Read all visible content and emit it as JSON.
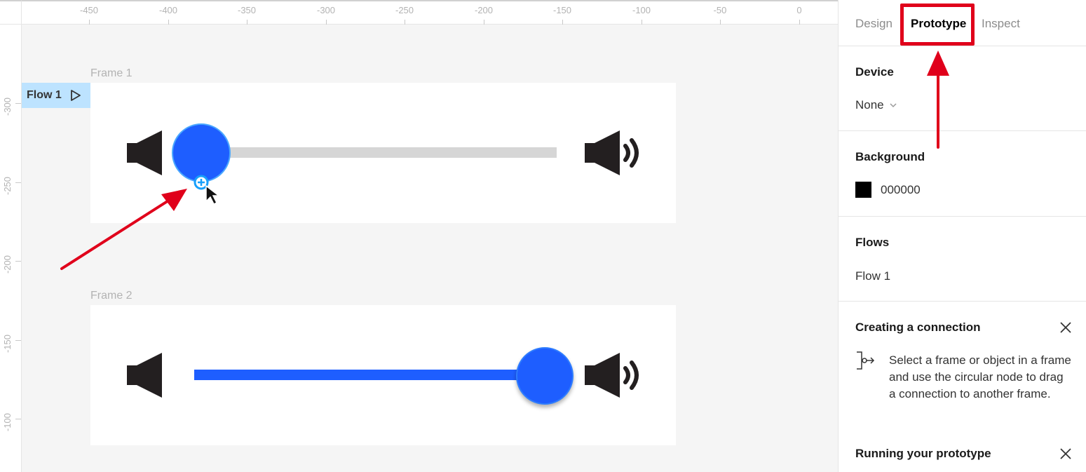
{
  "ruler": {
    "top_ticks": [
      "-450",
      "-400",
      "-350",
      "-300",
      "-250",
      "-200",
      "-150",
      "-100",
      "-50",
      "0"
    ],
    "left_ticks": [
      "-300",
      "-250",
      "-200",
      "-150",
      "-100"
    ]
  },
  "canvas": {
    "frame1_label": "Frame 1",
    "frame2_label": "Frame 2",
    "flow_tag": "Flow 1",
    "accent_color": "#1E5EFF",
    "frame1_slider_level": 0.0,
    "frame2_slider_level": 1.0
  },
  "panel": {
    "tabs": [
      {
        "label": "Design",
        "active": false
      },
      {
        "label": "Prototype",
        "active": true
      },
      {
        "label": "Inspect",
        "active": false
      }
    ],
    "device": {
      "title": "Device",
      "value": "None"
    },
    "background": {
      "title": "Background",
      "value": "000000",
      "color": "#000000"
    },
    "flows": {
      "title": "Flows",
      "items": [
        "Flow 1"
      ]
    },
    "connection_help": {
      "title": "Creating a connection",
      "text": "Select a frame or object in a frame and use the circular node to drag a connection to another frame."
    },
    "running_help": {
      "title": "Running your prototype"
    }
  },
  "annotations": {
    "arrow_color": "#E0001B"
  }
}
